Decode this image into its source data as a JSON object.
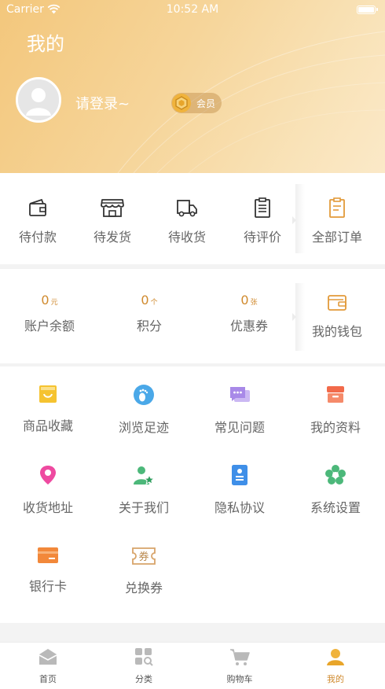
{
  "status_bar": {
    "carrier": "Carrier",
    "time": "10:52 AM"
  },
  "header": {
    "title": "我的",
    "login_prompt": "请登录~",
    "member_label": "会员"
  },
  "orders": [
    {
      "label": "待付款",
      "icon": "wallet-icon"
    },
    {
      "label": "待发货",
      "icon": "store-icon"
    },
    {
      "label": "待收货",
      "icon": "truck-icon"
    },
    {
      "label": "待评价",
      "icon": "clipboard-icon"
    },
    {
      "label": "全部订单",
      "icon": "order-list-icon"
    }
  ],
  "wallet": {
    "items": [
      {
        "value": "0",
        "unit": "元",
        "label": "账户余额"
      },
      {
        "value": "0",
        "unit": "个",
        "label": "积分"
      },
      {
        "value": "0",
        "unit": "张",
        "label": "优惠券"
      }
    ],
    "my_wallet_label": "我的钱包"
  },
  "services": [
    {
      "label": "商品收藏",
      "icon": "favorites-bag-icon",
      "color": "#f5c330"
    },
    {
      "label": "浏览足迹",
      "icon": "footprint-icon",
      "color": "#4aa8e8"
    },
    {
      "label": "常见问题",
      "icon": "chat-bubbles-icon",
      "color": "#a889e8"
    },
    {
      "label": "我的资料",
      "icon": "shop-profile-icon",
      "color": "#f26a4a"
    },
    {
      "label": "收货地址",
      "icon": "location-pin-icon",
      "color": "#ee4aa0"
    },
    {
      "label": "关于我们",
      "icon": "user-star-icon",
      "color": "#4cb87a"
    },
    {
      "label": "隐私协议",
      "icon": "document-icon",
      "color": "#3f8fe8"
    },
    {
      "label": "系统设置",
      "icon": "settings-flower-icon",
      "color": "#4cb87a"
    },
    {
      "label": "银行卡",
      "icon": "bank-card-icon",
      "color": "#f2883a"
    },
    {
      "label": "兑换券",
      "icon": "coupon-icon",
      "color": "#d8a46a",
      "icon_text": "券"
    }
  ],
  "tabbar": {
    "active": "我的",
    "tabs": [
      {
        "label": "首页",
        "icon": "home-icon"
      },
      {
        "label": "分类",
        "icon": "category-icon"
      },
      {
        "label": "购物车",
        "icon": "cart-icon"
      },
      {
        "label": "我的",
        "icon": "profile-icon"
      }
    ]
  },
  "colors": {
    "accent": "#d08a2e",
    "header_gradient_start": "#f3c77c",
    "header_gradient_end": "#fbe9c8"
  }
}
